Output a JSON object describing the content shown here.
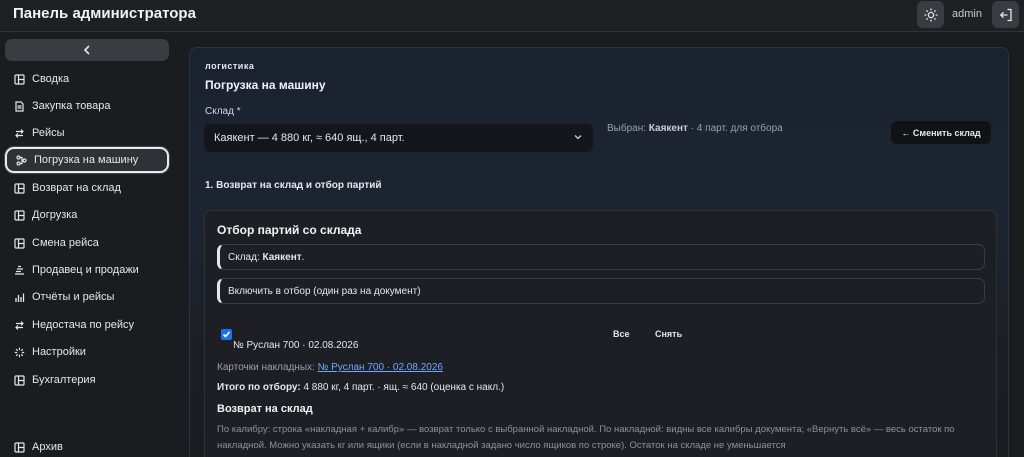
{
  "app": {
    "title": "Панель администратора",
    "user": "admin"
  },
  "icons": {
    "theme": "sun-icon",
    "logout": "logout-icon",
    "collapse": "chevron-left-icon"
  },
  "sidebar": {
    "items": [
      {
        "label": "Сводка",
        "icon": "layout-icon"
      },
      {
        "label": "Закупка товара",
        "icon": "document-icon"
      },
      {
        "label": "Рейсы",
        "icon": "swap-icon"
      },
      {
        "label": "Погрузка на машину",
        "icon": "nodes-icon",
        "active": true
      },
      {
        "label": "Возврат на склад",
        "icon": "layout-icon"
      },
      {
        "label": "Догрузка",
        "icon": "layout-icon"
      },
      {
        "label": "Смена рейса",
        "icon": "layout-icon"
      },
      {
        "label": "Продавец и продажи",
        "icon": "sales-icon"
      },
      {
        "label": "Отчёты и рейсы",
        "icon": "chart-icon"
      },
      {
        "label": "Недостача по рейсу",
        "icon": "swap-icon"
      },
      {
        "label": "Настройки",
        "icon": "sparkle-icon"
      },
      {
        "label": "Бухгалтерия",
        "icon": "layout-icon"
      }
    ],
    "archive": {
      "label": "Архив",
      "icon": "layout-icon"
    }
  },
  "main": {
    "section_tag": "логистика",
    "title": "Погрузка на машину",
    "warehouse_label": "Склад *",
    "warehouse_value": "Каякент — 4 880 кг, ≈ 640 ящ., 4 парт.",
    "selected_prefix": "Выбран:",
    "selected_name": "Каякент",
    "selected_suffix": "· 4 парт. для отбора",
    "change_button": "← Сменить склад",
    "step_heading": "1. Возврат на склад и отбор партий",
    "card": {
      "title": "Отбор партий со склада",
      "warehouse_prefix": "Склад:",
      "warehouse_name": "Каякент",
      "warehouse_dot": ".",
      "include_label": "Включить в отбор (один раз на документ)",
      "batch_label": "№ Руслан 700 · 02.08.2026",
      "batch_checked": true,
      "all_button": "Все",
      "clear_button": "Снять",
      "cards_label": "Карточки накладных:",
      "cards_link": "№ Руслан 700 · 02.08.2026",
      "total_label": "Итого по отбору:",
      "total_value": "4 880 кг, 4 парт. · ящ. ≈ 640 (оценка с накл.)",
      "return_heading": "Возврат на склад",
      "return_desc": "По калибру: строка «накладная + калибр» — возврат только с выбранной накладной. По накладной: видны все калибры документа; «Вернуть всё» — весь остаток по накладной. Можно указать кг или ящики (если в накладной задано число ящиков по строке). Остаток на складе не уменьшается"
    }
  },
  "colors": {
    "accent": "#1a73e8",
    "link": "#6fa8ff",
    "background": "#1b1c20"
  }
}
